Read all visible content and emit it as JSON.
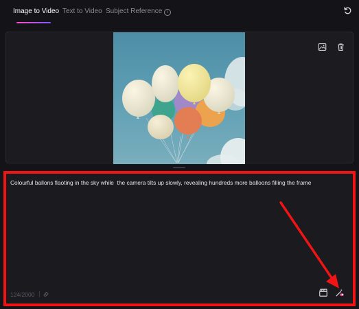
{
  "tabs": [
    {
      "label": "Image to Video",
      "active": true
    },
    {
      "label": "Text to Video",
      "active": false
    },
    {
      "label": "Subject Reference",
      "active": false
    }
  ],
  "icons": {
    "refresh": "refresh-icon",
    "info": "info-icon",
    "replace_image": "image-icon",
    "delete": "trash-icon",
    "camera_motion": "clapperboard-icon",
    "enhance_prompt": "magic-wand-icon",
    "clear": "eraser-icon"
  },
  "prompt": {
    "text": "Colourful ballons flaoting in the sky while  the camera tilts up slowly, revealing hundreds more balloons filling the frame",
    "char_count": "124/2000"
  },
  "colors": {
    "accent_start": "#ff4ecb",
    "accent_end": "#7b5cff",
    "highlight": "#f01414"
  }
}
